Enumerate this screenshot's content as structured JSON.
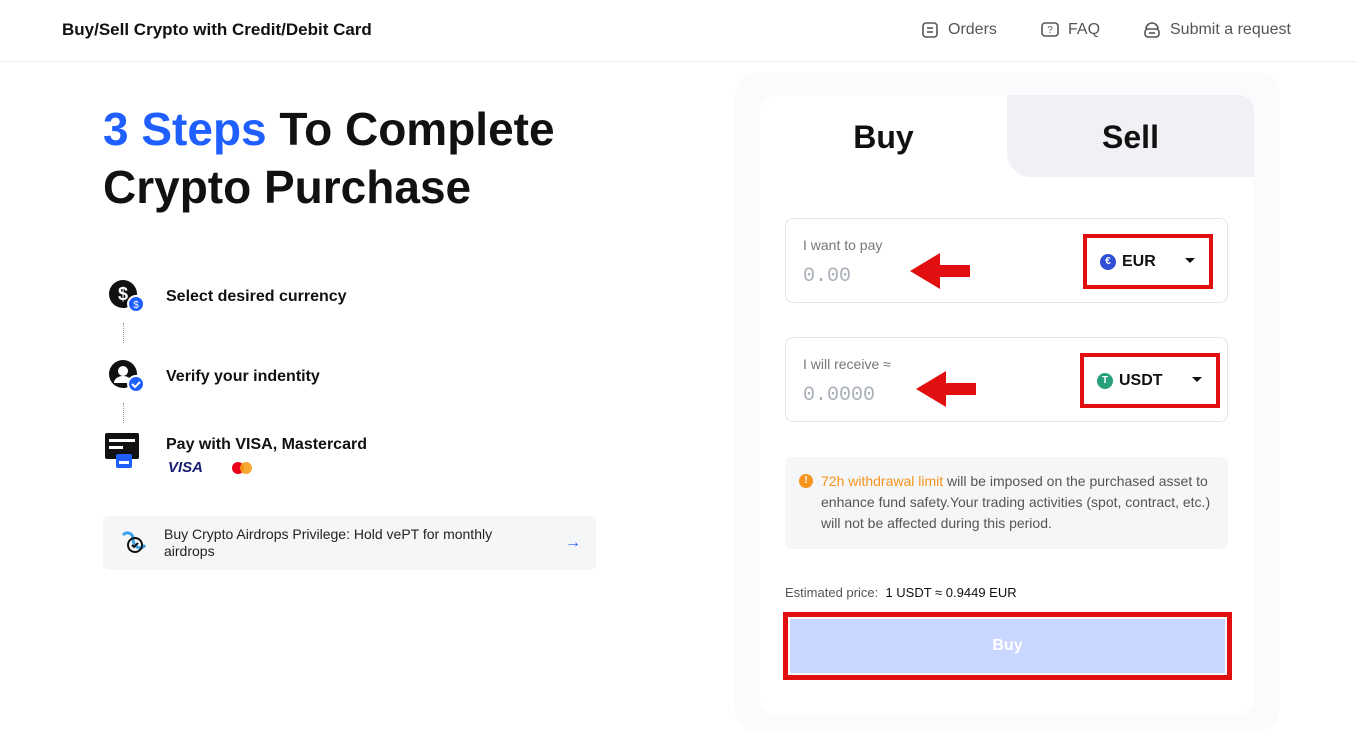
{
  "header": {
    "title": "Buy/Sell Crypto with Credit/Debit Card",
    "nav": [
      {
        "label": "Orders",
        "icon": "orders-icon"
      },
      {
        "label": "FAQ",
        "icon": "faq-icon"
      },
      {
        "label": "Submit a request",
        "icon": "support-icon"
      }
    ]
  },
  "hero": {
    "accent": "3 Steps",
    "title_rest": " To Complete",
    "title_line2": "Crypto Purchase"
  },
  "steps": [
    {
      "label": "Select desired currency",
      "icon": "currency-icon"
    },
    {
      "label": "Verify your indentity",
      "icon": "verify-icon"
    },
    {
      "label": "Pay with VISA, Mastercard",
      "icon": "card-icon",
      "visa": "VISA"
    }
  ],
  "promo": {
    "text": "Buy Crypto Airdrops Privilege: Hold vePT for monthly airdrops",
    "arrow": "→"
  },
  "trade": {
    "tabs": {
      "buy": "Buy",
      "sell": "Sell"
    },
    "pay": {
      "label": "I want to pay",
      "value": "0.00",
      "currency": "EUR",
      "currency_icon": "€"
    },
    "receive": {
      "label": "I will receive ≈",
      "value": "0.0000",
      "currency": "USDT",
      "currency_icon": "T"
    },
    "notice": {
      "highlight": "72h withdrawal limit",
      "text": " will be imposed on the purchased asset to enhance fund safety.Your trading activities (spot, contract, etc.) will not be affected during this period."
    },
    "estimate": {
      "label": "Estimated price:",
      "value": "1 USDT ≈ 0.9449 EUR"
    },
    "buy_button": "Buy"
  },
  "colors": {
    "accent": "#1f5eff",
    "annotation": "#e10f0f",
    "tether": "#26a17b",
    "euro": "#2e4fd6",
    "warning": "#f7941d"
  }
}
